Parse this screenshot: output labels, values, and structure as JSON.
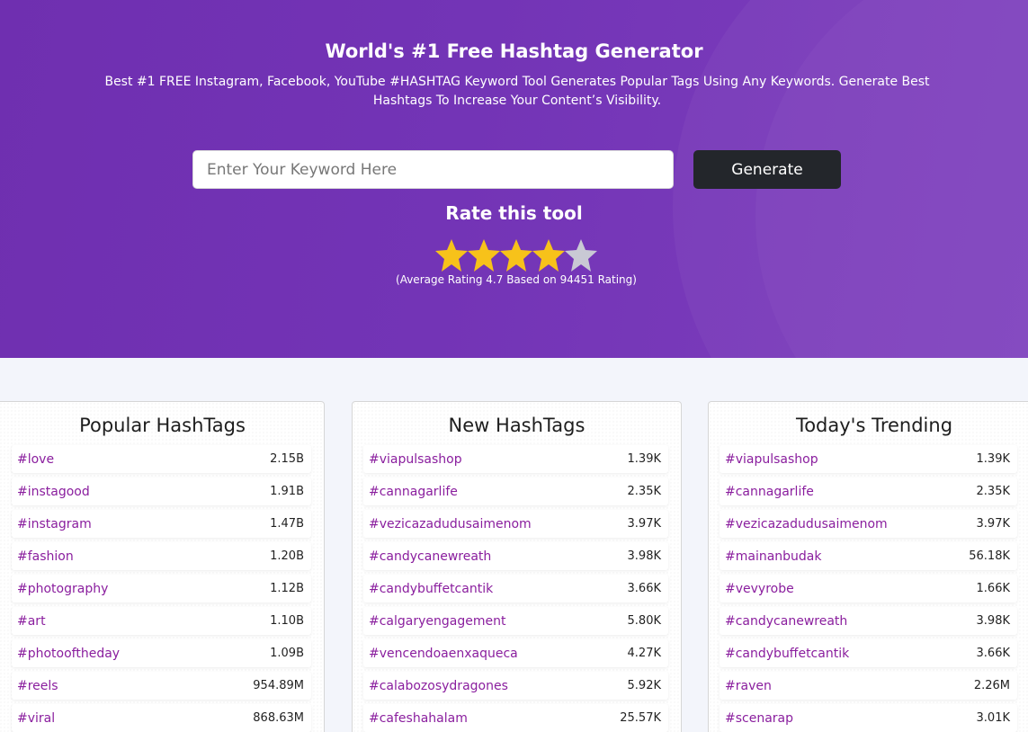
{
  "hero": {
    "title": "World's #1 Free Hashtag Generator",
    "subtitle": "Best #1 FREE Instagram, Facebook, YouTube #HASHTAG Keyword Tool Generates Popular Tags Using Any Keywords. Generate Best Hashtags To Increase Your Content’s Visibility.",
    "search_placeholder": "Enter Your Keyword Here",
    "search_value": "",
    "generate_label": "Generate",
    "rate_title": "Rate this tool",
    "rating_stars": 4,
    "rating_max": 5,
    "rating_note": "(Average Rating 4.7 Based on 94451 Rating)"
  },
  "colors": {
    "hero_bg": "#7334b6",
    "button_bg": "#23262b",
    "tag_color": "#8a1e9e",
    "star_filled": "#f7c21a",
    "star_empty": "#c9c9d4"
  },
  "icons": {
    "star": "star-icon"
  },
  "cards": [
    {
      "title": "Popular HashTags",
      "tags": [
        {
          "name": "#love",
          "count": "2.15B"
        },
        {
          "name": "#instagood",
          "count": "1.91B"
        },
        {
          "name": "#instagram",
          "count": "1.47B"
        },
        {
          "name": "#fashion",
          "count": "1.20B"
        },
        {
          "name": "#photography",
          "count": "1.12B"
        },
        {
          "name": "#art",
          "count": "1.10B"
        },
        {
          "name": "#photooftheday",
          "count": "1.09B"
        },
        {
          "name": "#reels",
          "count": "954.89M"
        },
        {
          "name": "#viral",
          "count": "868.63M"
        }
      ]
    },
    {
      "title": "New HashTags",
      "tags": [
        {
          "name": "#viapulsashop",
          "count": "1.39K"
        },
        {
          "name": "#cannagarlife",
          "count": "2.35K"
        },
        {
          "name": "#vezicazadudusaimenom",
          "count": "3.97K"
        },
        {
          "name": "#candycanewreath",
          "count": "3.98K"
        },
        {
          "name": "#candybuffetcantik",
          "count": "3.66K"
        },
        {
          "name": "#calgaryengagement",
          "count": "5.80K"
        },
        {
          "name": "#vencendoaenxaqueca",
          "count": "4.27K"
        },
        {
          "name": "#calabozosydragones",
          "count": "5.92K"
        },
        {
          "name": "#cafeshahalam",
          "count": "25.57K"
        }
      ]
    },
    {
      "title": "Today's Trending",
      "tags": [
        {
          "name": "#viapulsashop",
          "count": "1.39K"
        },
        {
          "name": "#cannagarlife",
          "count": "2.35K"
        },
        {
          "name": "#vezicazadudusaimenom",
          "count": "3.97K"
        },
        {
          "name": "#mainanbudak",
          "count": "56.18K"
        },
        {
          "name": "#vevyrobe",
          "count": "1.66K"
        },
        {
          "name": "#candycanewreath",
          "count": "3.98K"
        },
        {
          "name": "#candybuffetcantik",
          "count": "3.66K"
        },
        {
          "name": "#raven",
          "count": "2.26M"
        },
        {
          "name": "#scenarap",
          "count": "3.01K"
        }
      ]
    }
  ]
}
